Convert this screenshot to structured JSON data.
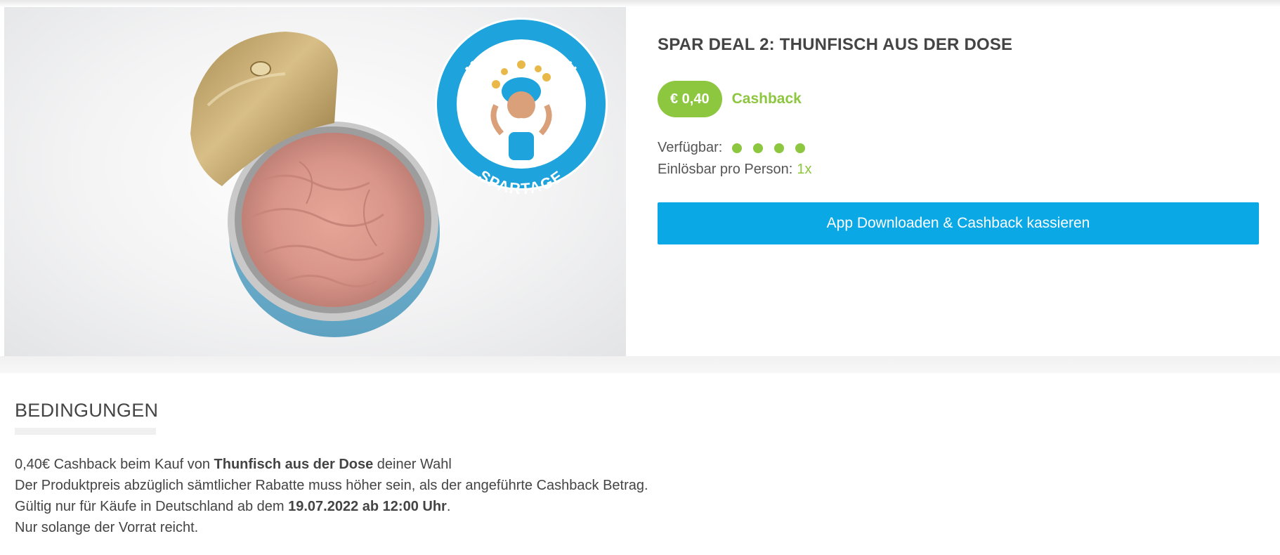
{
  "deal": {
    "title": "SPAR DEAL 2: THUNFISCH AUS DER DOSE",
    "cashback_amount": "€ 0,40",
    "cashback_label": "Cashback",
    "available_label": "Verfügbar:",
    "availability_dots": 4,
    "redeem_label": "Einlösbar pro Person:",
    "redeem_value": "1x",
    "cta_label": "App Downloaden & Cashback kassieren"
  },
  "badge": {
    "top_text": "MARKTGURU",
    "bottom_text": "SPARTAGE"
  },
  "terms": {
    "heading": "BEDINGUNGEN",
    "line1_pre": "0,40€ Cashback beim Kauf von ",
    "line1_bold": "Thunfisch aus der Dose",
    "line1_post": " deiner Wahl",
    "line2": "Der Produktpreis abzüglich sämtlicher Rabatte muss höher sein, als der angeführte Cashback Betrag.",
    "line3_pre": "Gültig nur für Käufe in Deutschland ab dem ",
    "line3_bold": "19.07.2022 ab 12:00 Uhr",
    "line3_post": ".",
    "line4": "Nur solange der Vorrat reicht."
  },
  "colors": {
    "accent_green": "#8dc63f",
    "cta_blue": "#0ba8e6",
    "badge_blue": "#1ea3dc"
  }
}
